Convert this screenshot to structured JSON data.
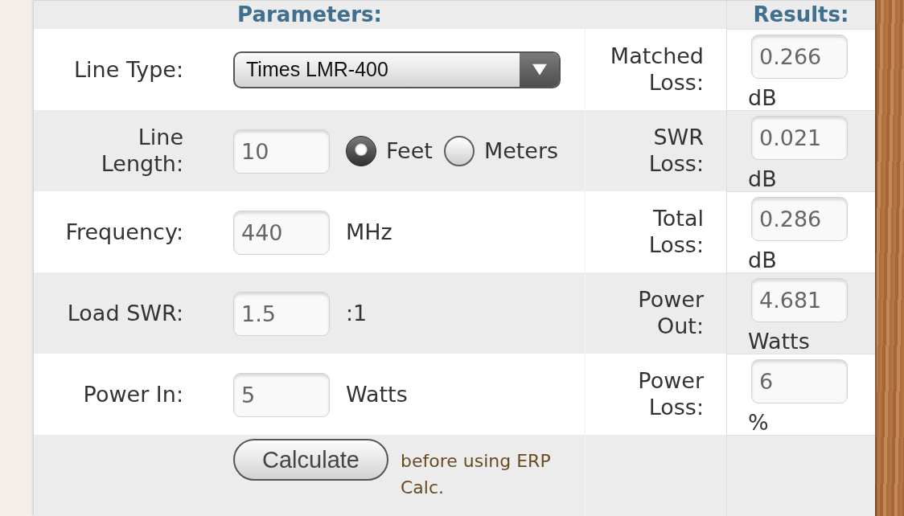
{
  "headings": {
    "parameters": "Parameters:",
    "results": "Results:"
  },
  "parameters": [
    {
      "kind": "select",
      "label": "Line Type:",
      "value": "Times LMR-400"
    },
    {
      "kind": "length",
      "label": "Line Length:",
      "value": "10",
      "units": [
        {
          "label": "Feet",
          "selected": true
        },
        {
          "label": "Meters",
          "selected": false
        }
      ]
    },
    {
      "kind": "number",
      "label": "Frequency:",
      "value": "440",
      "unit": "MHz"
    },
    {
      "kind": "number",
      "label": "Load SWR:",
      "value": "1.5",
      "unit": ":1"
    },
    {
      "kind": "number",
      "label": "Power In:",
      "value": "5",
      "unit": "Watts"
    }
  ],
  "results": [
    {
      "label": "Matched Loss:",
      "value": "0.266",
      "unit": "dB"
    },
    {
      "label": "SWR Loss:",
      "value": "0.021",
      "unit": "dB"
    },
    {
      "label": "Total Loss:",
      "value": "0.286",
      "unit": "dB"
    },
    {
      "label": "Power Out:",
      "value": "4.681",
      "unit": "Watts"
    },
    {
      "label": "Power Loss:",
      "value": "6",
      "unit": "%"
    }
  ],
  "calculate_button": "Calculate",
  "calculate_note": "before using ERP Calc."
}
